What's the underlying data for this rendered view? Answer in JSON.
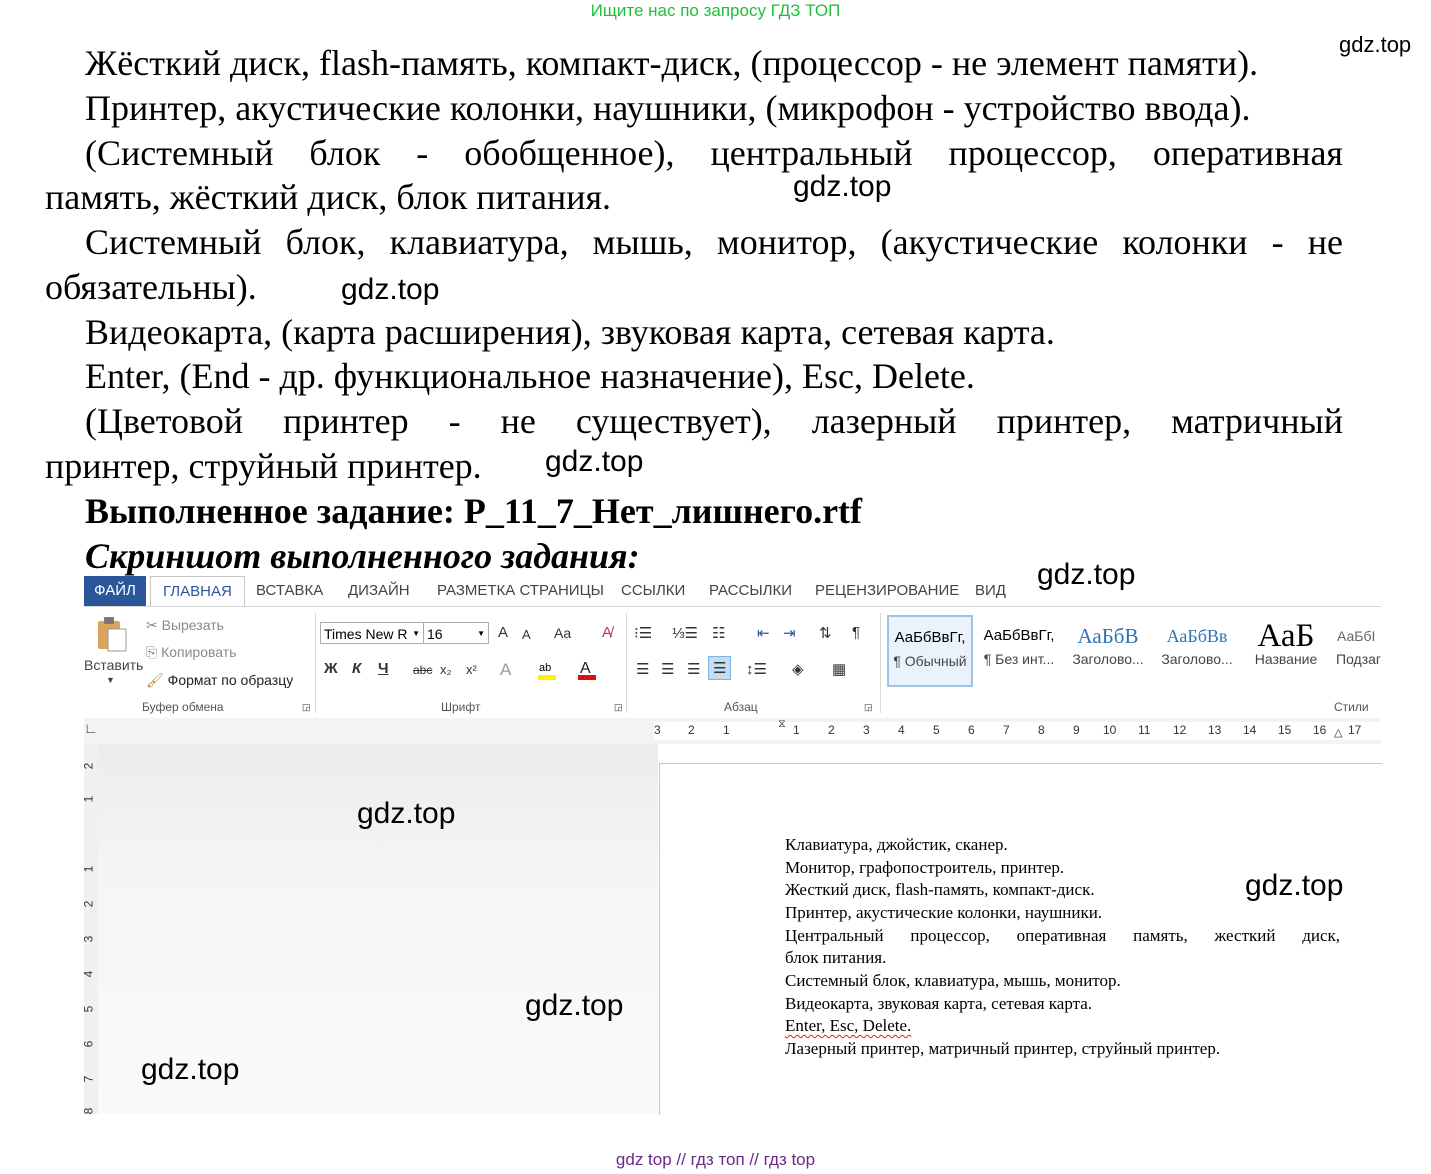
{
  "top_banner": "Ищите нас по запросу ГДЗ ТОП",
  "watermark": "gdz.top",
  "lines": [
    "Жёсткий диск, flash-память, компакт-диск, (процессор - не элемент памяти).",
    "Принтер, акустические колонки, наушники, (микрофон -  устройство ввода).",
    "(Системный блок - обобщенное), центральный процессор, оперативная",
    "память, жёсткий диск, блок питания.",
    "Системный блок, клавиатура, мышь, монитор, (акустические колонки - не",
    "обязательны).",
    "Видеокарта, (карта расширения), звуковая карта, сетевая карта.",
    "Enter, (End  - др. функциональное назначение), Esc, Delete.",
    "(Цветовой принтер - не существует), лазерный принтер, матричный",
    "принтер, струйный принтер."
  ],
  "completed_task": "Выполненное задание: Р_11_7_Нет_лишнего.rtf",
  "screenshot_heading": "Скриншот выполненного задания:",
  "word": {
    "tabs": [
      "ФАЙЛ",
      "ГЛАВНАЯ",
      "ВСТАВКА",
      "ДИЗАЙН",
      "РАЗМЕТКА СТРАНИЦЫ",
      "ССЫЛКИ",
      "РАССЫЛКИ",
      "РЕЦЕНЗИРОВАНИЕ",
      "ВИД"
    ],
    "clipboard": {
      "paste": "Вставить",
      "cut": "Вырезать",
      "copy": "Копировать",
      "format_painter": "Формат по образцу",
      "label": "Буфер обмена"
    },
    "font": {
      "name": "Times New R",
      "size": "16",
      "bold": "Ж",
      "italic": "К",
      "underline": "Ч",
      "strike": "abc",
      "sub": "x₂",
      "sup": "x²",
      "grow": "A",
      "shrink": "A",
      "case": "Aa",
      "label": "Шрифт"
    },
    "paragraph_label": "Абзац",
    "styles": [
      {
        "sample": "АаБбВвГг,",
        "name": "¶ Обычный"
      },
      {
        "sample": "АаБбВвГг,",
        "name": "¶ Без инт..."
      },
      {
        "sample": "АаБбВ",
        "name": "Заголово..."
      },
      {
        "sample": "АаБбВв",
        "name": "Заголово..."
      },
      {
        "sample": "АаБ",
        "name": "Название"
      },
      {
        "sample": "АаБбІ",
        "name": "Подзаг"
      }
    ],
    "styles_label": "Стили",
    "ruler_h": [
      "3",
      "2",
      "1",
      "1",
      "2",
      "3",
      "4",
      "5",
      "6",
      "7",
      "8",
      "9",
      "10",
      "11",
      "12",
      "13",
      "14",
      "15",
      "16",
      "17"
    ],
    "ruler_v": [
      "2",
      "1",
      "1",
      "2",
      "3",
      "4",
      "5",
      "6",
      "7",
      "8"
    ],
    "doc_lines": [
      "Клавиатура, джойстик, сканер.",
      "Монитор, графопостроитель, принтер.",
      "Жесткий диск, flash-память, компакт-диск.",
      "Принтер, акустические колонки, наушники.",
      "Центральный процессор, оперативная память, жесткий диск,",
      "блок питания.",
      "Системный блок, клавиатура, мышь, монитор.",
      "Видеокарта, звуковая карта, сетевая карта.",
      "Enter, Esc, Delete.",
      "Лазерный принтер, матричный принтер, струйный принтер."
    ]
  },
  "footer": "gdz top  //  гдз топ  //  гдз top"
}
